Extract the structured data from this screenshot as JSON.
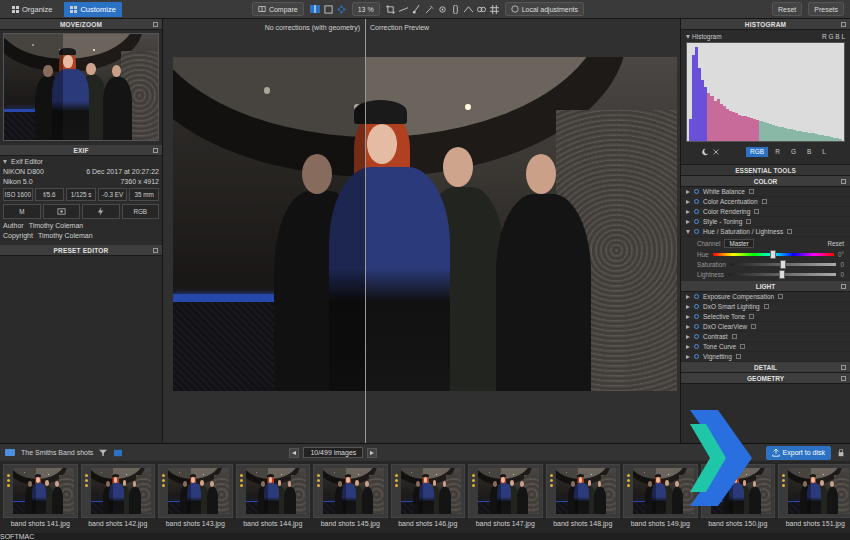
{
  "toolbar": {
    "tabs": [
      {
        "label": "Organize",
        "selected": false
      },
      {
        "label": "Customize",
        "selected": true
      }
    ],
    "compare": "Compare",
    "zoom": "13 %",
    "local_adjustments": "Local adjustments",
    "reset": "Reset",
    "presets": "Presets"
  },
  "left_panel": {
    "move_zoom": "MOVE/ZOOM",
    "exif": {
      "title": "EXIF",
      "editor": "Exif Editor",
      "editor_expanded": true,
      "camera": "NIKON D800",
      "date": "6 Dec 2017 at 20:27:22",
      "lens": "Nikon 5.0",
      "size": "7360 x 4912",
      "settings": [
        "ISO 1600",
        "f/5.6",
        "1/125 s",
        "-0.3 EV",
        "35 mm"
      ],
      "modes": [
        "M",
        "RGB"
      ],
      "fields": [
        {
          "label": "Author",
          "value": "Timothy Coleman"
        },
        {
          "label": "Copyright",
          "value": "Timothy Coleman"
        }
      ]
    },
    "preset_editor": "PRESET EDITOR"
  },
  "viewer": {
    "before_label": "No corrections (with geometry)",
    "after_label": "Correction Preview"
  },
  "right_panel": {
    "histogram": {
      "title": "HISTOGRAM",
      "label": "Histogram",
      "legend": "R G B L",
      "values": [
        22,
        88,
        96,
        74,
        62,
        55,
        49,
        46,
        41,
        43,
        38,
        36,
        33,
        31,
        30,
        29,
        27,
        26,
        26,
        24,
        23,
        22,
        21,
        20,
        19,
        18,
        17,
        16,
        15,
        14,
        14,
        13,
        12,
        12,
        11,
        10,
        10,
        9,
        9,
        8,
        8,
        7,
        6,
        6,
        5,
        5,
        4,
        3,
        3,
        2
      ],
      "channels": [
        {
          "label": "RGB",
          "selected": true
        },
        {
          "label": "R",
          "selected": false
        },
        {
          "label": "G",
          "selected": false
        },
        {
          "label": "B",
          "selected": false
        },
        {
          "label": "L",
          "selected": false
        }
      ]
    },
    "essential_tools": "ESSENTIAL TOOLS",
    "sections": [
      {
        "title": "COLOR",
        "expanded": true,
        "items": [
          {
            "label": "White Balance",
            "kind": "tool",
            "expanded": false
          },
          {
            "label": "Color Accentuation",
            "kind": "tool",
            "expanded": false
          },
          {
            "label": "Color Rendering",
            "kind": "tool",
            "expanded": false
          },
          {
            "label": "Style - Toning",
            "kind": "tool",
            "expanded": false
          },
          {
            "label": "Hue / Saturation / Lightness",
            "kind": "hsl",
            "expanded": true,
            "channel_label": "Channel",
            "channel": "Master",
            "reset": "Reset",
            "sliders": [
              {
                "label": "Hue",
                "kind": "hue",
                "level": 0.5,
                "reading": "0°"
              },
              {
                "label": "Saturation",
                "kind": "plain",
                "level": 0.5,
                "reading": "0"
              },
              {
                "label": "Lightness",
                "kind": "plain",
                "level": 0.5,
                "reading": "0"
              }
            ]
          }
        ]
      },
      {
        "title": "LIGHT",
        "expanded": true,
        "items": [
          {
            "label": "Exposure Compensation",
            "kind": "tool",
            "expanded": false
          },
          {
            "label": "DxO Smart Lighting",
            "kind": "tool",
            "expanded": false
          },
          {
            "label": "Selective Tone",
            "kind": "tool",
            "expanded": false
          },
          {
            "label": "DxO ClearView",
            "kind": "tool",
            "expanded": false
          },
          {
            "label": "Contrast",
            "kind": "tool",
            "expanded": false
          },
          {
            "label": "Tone Curve",
            "kind": "tool",
            "expanded": false
          },
          {
            "label": "Vignetting",
            "kind": "tool",
            "expanded": false
          }
        ]
      },
      {
        "title": "DETAIL",
        "expanded": false,
        "items": []
      },
      {
        "title": "GEOMETRY",
        "expanded": false,
        "items": []
      }
    ]
  },
  "filmstrip": {
    "folder": "The Smiths Band shots",
    "count": "10/499 images",
    "export": "Export to disk",
    "thumbnails": [
      {
        "label": "band shots 141.jpg"
      },
      {
        "label": "band shots 142.jpg"
      },
      {
        "label": "band shots 143.jpg"
      },
      {
        "label": "band shots 144.jpg"
      },
      {
        "label": "band shots 145.jpg"
      },
      {
        "label": "band shots 146.jpg"
      },
      {
        "label": "band shots 147.jpg"
      },
      {
        "label": "band shots 148.jpg"
      },
      {
        "label": "band shots 149.jpg"
      },
      {
        "label": "band shots 150.jpg"
      },
      {
        "label": "band shots 151.jpg"
      }
    ]
  },
  "watermark": {
    "text": "SOFTMAC"
  }
}
